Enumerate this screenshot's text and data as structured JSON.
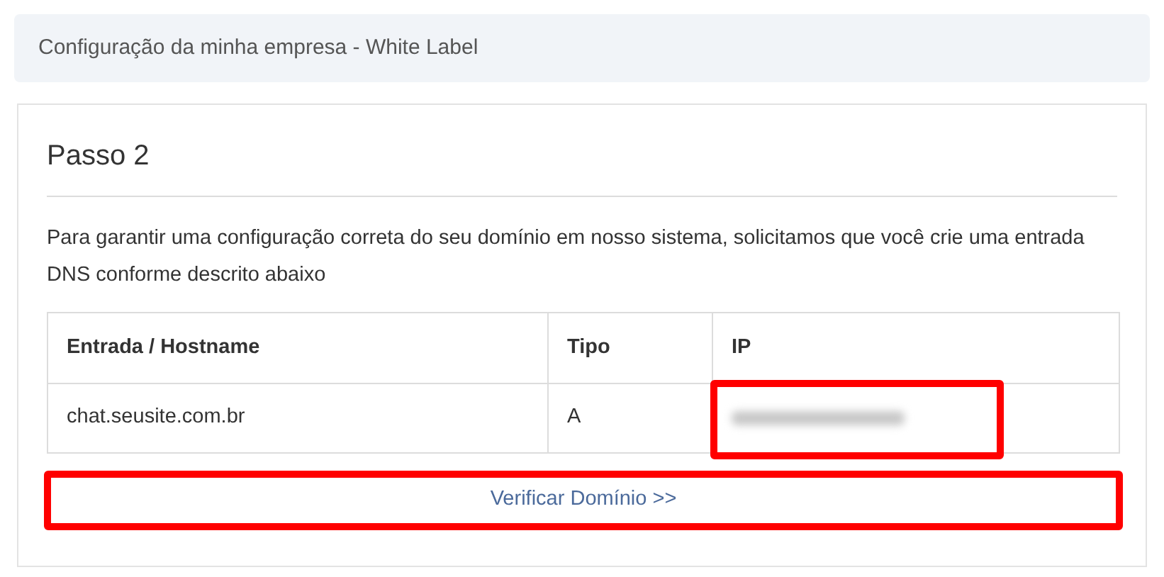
{
  "header": {
    "title": "Configuração da minha empresa - White Label"
  },
  "step": {
    "title": "Passo 2",
    "description": "Para garantir uma configuração correta do seu domínio em nosso sistema, solicitamos que você crie uma entrada DNS conforme descrito abaixo"
  },
  "table": {
    "columns": [
      "Entrada / Hostname",
      "Tipo",
      "IP"
    ],
    "rows": [
      {
        "hostname": "chat.seusite.com.br",
        "type": "A",
        "ip_blurred": true
      }
    ]
  },
  "verify_button": {
    "label": "Verificar Domínio >>",
    "highlighted": true
  }
}
